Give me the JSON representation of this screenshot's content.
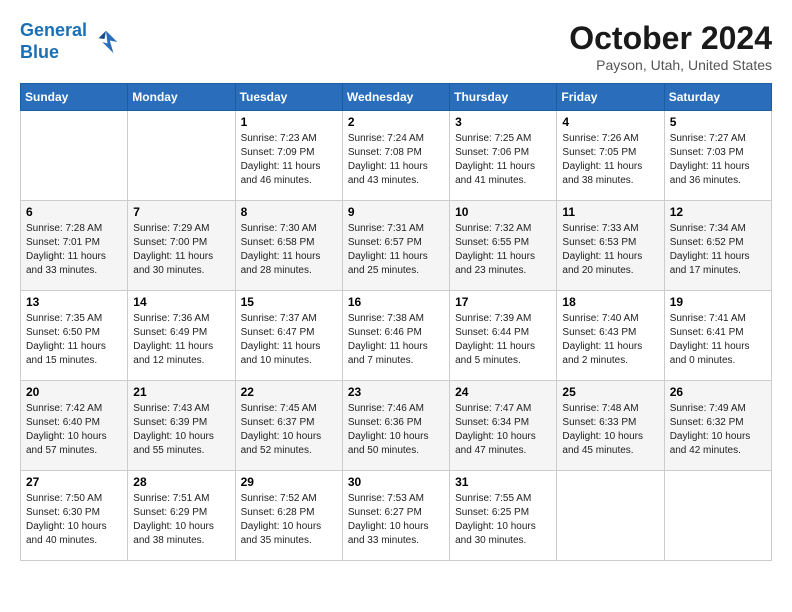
{
  "header": {
    "logo_line1": "General",
    "logo_line2": "Blue",
    "month": "October 2024",
    "location": "Payson, Utah, United States"
  },
  "weekdays": [
    "Sunday",
    "Monday",
    "Tuesday",
    "Wednesday",
    "Thursday",
    "Friday",
    "Saturday"
  ],
  "weeks": [
    [
      {
        "day": "",
        "info": ""
      },
      {
        "day": "",
        "info": ""
      },
      {
        "day": "1",
        "info": "Sunrise: 7:23 AM\nSunset: 7:09 PM\nDaylight: 11 hours and 46 minutes."
      },
      {
        "day": "2",
        "info": "Sunrise: 7:24 AM\nSunset: 7:08 PM\nDaylight: 11 hours and 43 minutes."
      },
      {
        "day": "3",
        "info": "Sunrise: 7:25 AM\nSunset: 7:06 PM\nDaylight: 11 hours and 41 minutes."
      },
      {
        "day": "4",
        "info": "Sunrise: 7:26 AM\nSunset: 7:05 PM\nDaylight: 11 hours and 38 minutes."
      },
      {
        "day": "5",
        "info": "Sunrise: 7:27 AM\nSunset: 7:03 PM\nDaylight: 11 hours and 36 minutes."
      }
    ],
    [
      {
        "day": "6",
        "info": "Sunrise: 7:28 AM\nSunset: 7:01 PM\nDaylight: 11 hours and 33 minutes."
      },
      {
        "day": "7",
        "info": "Sunrise: 7:29 AM\nSunset: 7:00 PM\nDaylight: 11 hours and 30 minutes."
      },
      {
        "day": "8",
        "info": "Sunrise: 7:30 AM\nSunset: 6:58 PM\nDaylight: 11 hours and 28 minutes."
      },
      {
        "day": "9",
        "info": "Sunrise: 7:31 AM\nSunset: 6:57 PM\nDaylight: 11 hours and 25 minutes."
      },
      {
        "day": "10",
        "info": "Sunrise: 7:32 AM\nSunset: 6:55 PM\nDaylight: 11 hours and 23 minutes."
      },
      {
        "day": "11",
        "info": "Sunrise: 7:33 AM\nSunset: 6:53 PM\nDaylight: 11 hours and 20 minutes."
      },
      {
        "day": "12",
        "info": "Sunrise: 7:34 AM\nSunset: 6:52 PM\nDaylight: 11 hours and 17 minutes."
      }
    ],
    [
      {
        "day": "13",
        "info": "Sunrise: 7:35 AM\nSunset: 6:50 PM\nDaylight: 11 hours and 15 minutes."
      },
      {
        "day": "14",
        "info": "Sunrise: 7:36 AM\nSunset: 6:49 PM\nDaylight: 11 hours and 12 minutes."
      },
      {
        "day": "15",
        "info": "Sunrise: 7:37 AM\nSunset: 6:47 PM\nDaylight: 11 hours and 10 minutes."
      },
      {
        "day": "16",
        "info": "Sunrise: 7:38 AM\nSunset: 6:46 PM\nDaylight: 11 hours and 7 minutes."
      },
      {
        "day": "17",
        "info": "Sunrise: 7:39 AM\nSunset: 6:44 PM\nDaylight: 11 hours and 5 minutes."
      },
      {
        "day": "18",
        "info": "Sunrise: 7:40 AM\nSunset: 6:43 PM\nDaylight: 11 hours and 2 minutes."
      },
      {
        "day": "19",
        "info": "Sunrise: 7:41 AM\nSunset: 6:41 PM\nDaylight: 11 hours and 0 minutes."
      }
    ],
    [
      {
        "day": "20",
        "info": "Sunrise: 7:42 AM\nSunset: 6:40 PM\nDaylight: 10 hours and 57 minutes."
      },
      {
        "day": "21",
        "info": "Sunrise: 7:43 AM\nSunset: 6:39 PM\nDaylight: 10 hours and 55 minutes."
      },
      {
        "day": "22",
        "info": "Sunrise: 7:45 AM\nSunset: 6:37 PM\nDaylight: 10 hours and 52 minutes."
      },
      {
        "day": "23",
        "info": "Sunrise: 7:46 AM\nSunset: 6:36 PM\nDaylight: 10 hours and 50 minutes."
      },
      {
        "day": "24",
        "info": "Sunrise: 7:47 AM\nSunset: 6:34 PM\nDaylight: 10 hours and 47 minutes."
      },
      {
        "day": "25",
        "info": "Sunrise: 7:48 AM\nSunset: 6:33 PM\nDaylight: 10 hours and 45 minutes."
      },
      {
        "day": "26",
        "info": "Sunrise: 7:49 AM\nSunset: 6:32 PM\nDaylight: 10 hours and 42 minutes."
      }
    ],
    [
      {
        "day": "27",
        "info": "Sunrise: 7:50 AM\nSunset: 6:30 PM\nDaylight: 10 hours and 40 minutes."
      },
      {
        "day": "28",
        "info": "Sunrise: 7:51 AM\nSunset: 6:29 PM\nDaylight: 10 hours and 38 minutes."
      },
      {
        "day": "29",
        "info": "Sunrise: 7:52 AM\nSunset: 6:28 PM\nDaylight: 10 hours and 35 minutes."
      },
      {
        "day": "30",
        "info": "Sunrise: 7:53 AM\nSunset: 6:27 PM\nDaylight: 10 hours and 33 minutes."
      },
      {
        "day": "31",
        "info": "Sunrise: 7:55 AM\nSunset: 6:25 PM\nDaylight: 10 hours and 30 minutes."
      },
      {
        "day": "",
        "info": ""
      },
      {
        "day": "",
        "info": ""
      }
    ]
  ]
}
